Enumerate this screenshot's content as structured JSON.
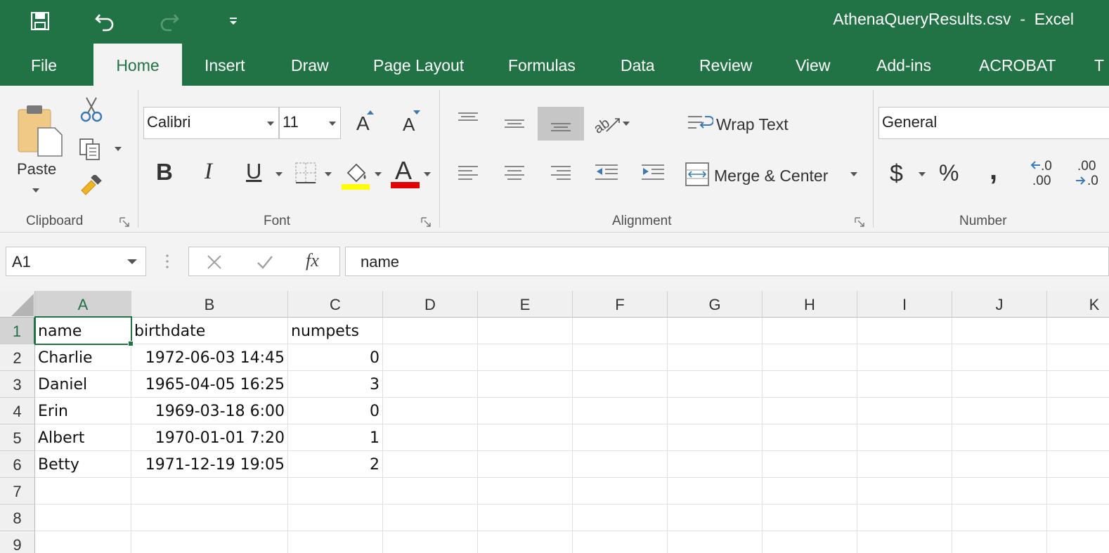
{
  "window": {
    "title": "AthenaQueryResults.csv  -  Excel",
    "qat": {
      "save_icon": "save-icon",
      "undo_icon": "undo-icon",
      "redo_icon": "redo-icon",
      "customize_icon": "customize-qat-icon"
    }
  },
  "tabs": [
    {
      "label": "File",
      "active": false
    },
    {
      "label": "Home",
      "active": true
    },
    {
      "label": "Insert",
      "active": false
    },
    {
      "label": "Draw",
      "active": false
    },
    {
      "label": "Page Layout",
      "active": false
    },
    {
      "label": "Formulas",
      "active": false
    },
    {
      "label": "Data",
      "active": false
    },
    {
      "label": "Review",
      "active": false
    },
    {
      "label": "View",
      "active": false
    },
    {
      "label": "Add-ins",
      "active": false
    },
    {
      "label": "ACROBAT",
      "active": false
    },
    {
      "label": "T",
      "active": false
    }
  ],
  "ribbon": {
    "clipboard": {
      "label": "Clipboard",
      "paste_label": "Paste"
    },
    "font": {
      "label": "Font",
      "font_name": "Calibri",
      "font_size": "11",
      "bold": "B",
      "italic": "I",
      "underline": "U",
      "font_color_glyph": "A",
      "grow_glyph": "A",
      "shrink_glyph": "A"
    },
    "alignment": {
      "label": "Alignment",
      "wrap_text": "Wrap Text",
      "merge_center": "Merge & Center"
    },
    "number": {
      "label": "Number",
      "format": "General",
      "currency": "$",
      "percent": "%",
      "comma": ",",
      "inc_decimal_top": ".0",
      "inc_decimal_bottom": ".00",
      "dec_decimal_top": ".00",
      "dec_decimal_bottom": ".0"
    },
    "colors": {
      "highlight": "#ffff00",
      "font_color": "#e00000",
      "accent": "#217346"
    }
  },
  "formula_bar": {
    "name_box": "A1",
    "fx": "fx",
    "content": "name"
  },
  "grid": {
    "columns": [
      "A",
      "B",
      "C",
      "D",
      "E",
      "F",
      "G",
      "H",
      "I",
      "J",
      "K"
    ],
    "selected_column": "A",
    "selected_row": "1",
    "rows": [
      {
        "num": "1",
        "cells": [
          "name",
          "birthdate",
          "numpets"
        ]
      },
      {
        "num": "2",
        "cells": [
          "Charlie",
          "1972-06-03 14:45",
          "0"
        ]
      },
      {
        "num": "3",
        "cells": [
          "Daniel",
          "1965-04-05 16:25",
          "3"
        ]
      },
      {
        "num": "4",
        "cells": [
          "Erin",
          "1969-03-18 6:00",
          "0"
        ]
      },
      {
        "num": "5",
        "cells": [
          "Albert",
          "1970-01-01 7:20",
          "1"
        ]
      },
      {
        "num": "6",
        "cells": [
          "Betty",
          "1971-12-19 19:05",
          "2"
        ]
      },
      {
        "num": "7",
        "cells": [
          "",
          "",
          ""
        ]
      },
      {
        "num": "8",
        "cells": [
          "",
          "",
          ""
        ]
      },
      {
        "num": "9",
        "cells": [
          "",
          "",
          ""
        ]
      }
    ]
  }
}
